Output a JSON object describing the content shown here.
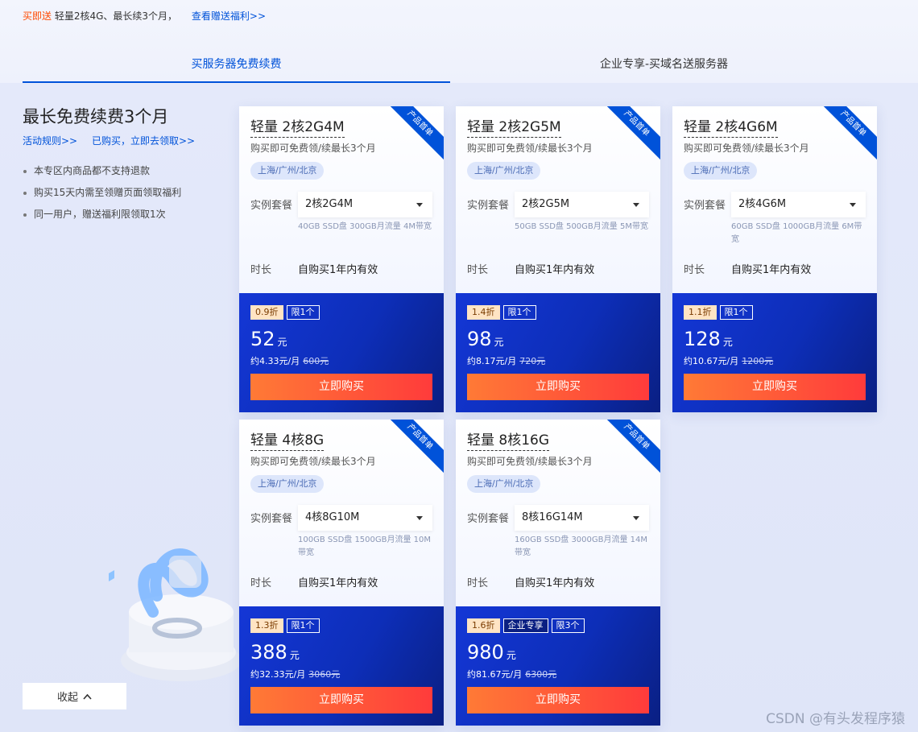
{
  "promo": {
    "highlight": "买即送",
    "text": "轻量2核4G、最长续3个月，",
    "link": "查看赠送福利>>"
  },
  "tabs": [
    {
      "label": "买服务器免费续费"
    },
    {
      "label": "企业专享-买域名送服务器"
    }
  ],
  "left": {
    "title": "最长免费续费3个月",
    "link_rules": "活动规则>>",
    "link_claim": "已购买，立即去领取>>",
    "notes": [
      "本专区内商品都不支持退款",
      "购买15天内需至领赠页面领取福利",
      "同一用户，赠送福利限领取1次"
    ],
    "collapse_label": "收起"
  },
  "common": {
    "ribbon": "产品首单",
    "subtitle": "购买即可免费领/续最长3个月",
    "region": "上海/广州/北京",
    "plan_label": "实例套餐",
    "duration_label": "时长",
    "duration_value": "自购买1年内有效",
    "buy_label": "立即购买",
    "price_unit": "元"
  },
  "cards": [
    {
      "title": "轻量 2核2G4M",
      "plan": "2核2G4M",
      "spec": "40GB SSD盘 300GB月流量 4M带宽",
      "discount": "0.9折",
      "badge_ent": "",
      "limit": "限1个",
      "price": "52",
      "monthly": "约4.33元/月",
      "original": "600元"
    },
    {
      "title": "轻量 2核2G5M",
      "plan": "2核2G5M",
      "spec": "50GB SSD盘 500GB月流量 5M带宽",
      "discount": "1.4折",
      "badge_ent": "",
      "limit": "限1个",
      "price": "98",
      "monthly": "约8.17元/月",
      "original": "720元"
    },
    {
      "title": "轻量 2核4G6M",
      "plan": "2核4G6M",
      "spec": "60GB SSD盘 1000GB月流量 6M带宽",
      "discount": "1.1折",
      "badge_ent": "",
      "limit": "限1个",
      "price": "128",
      "monthly": "约10.67元/月",
      "original": "1200元"
    },
    {
      "title": "轻量 4核8G",
      "plan": "4核8G10M",
      "spec": "100GB SSD盘 1500GB月流量 10M带宽",
      "discount": "1.3折",
      "badge_ent": "",
      "limit": "限1个",
      "price": "388",
      "monthly": "约32.33元/月",
      "original": "3060元"
    },
    {
      "title": "轻量 8核16G",
      "plan": "8核16G14M",
      "spec": "160GB SSD盘 3000GB月流量 14M带宽",
      "discount": "1.6折",
      "badge_ent": "企业专享",
      "limit": "限3个",
      "price": "980",
      "monthly": "约81.67元/月",
      "original": "6300元"
    }
  ],
  "watermark": "CSDN @有头发程序猿"
}
